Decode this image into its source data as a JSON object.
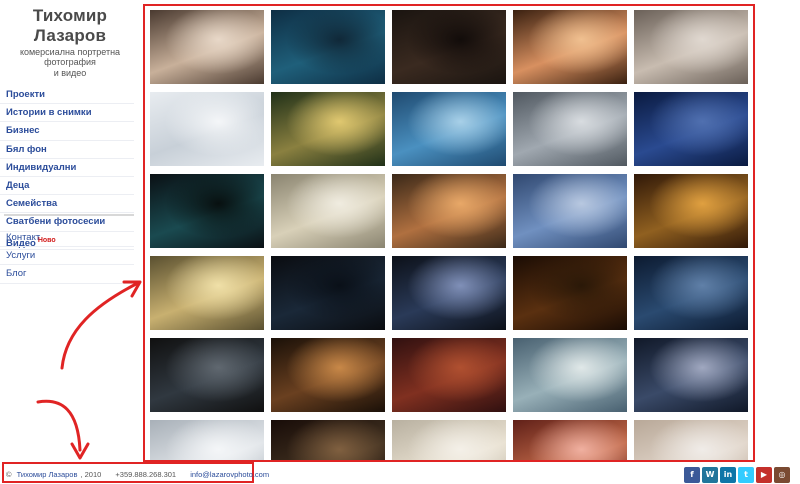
{
  "brand": {
    "name": "Тихомир Лазаров",
    "tagline_1": "комерсиална портретна фотография",
    "tagline_2": "и видео"
  },
  "nav": {
    "items": [
      {
        "label": "Проекти"
      },
      {
        "label": "Истории в снимки"
      },
      {
        "label": "Бизнес"
      },
      {
        "label": "Бял фон"
      },
      {
        "label": "Индивидуални"
      },
      {
        "label": "Деца"
      },
      {
        "label": "Семейства"
      },
      {
        "label": "Сватбени фотосесии"
      },
      {
        "label": "Видео",
        "badge": "Ново"
      }
    ],
    "secondary": [
      {
        "label": "Контакт"
      },
      {
        "label": "Услуги"
      },
      {
        "label": "Блог"
      }
    ]
  },
  "footer": {
    "copyright": "©",
    "name": "Тихомир Лазаров",
    "year": ", 2010",
    "phone": "+359.888.268.301",
    "email": "info@lazarovphoto.com"
  },
  "social": [
    {
      "icon": "facebook-icon",
      "glyph": "f",
      "color": "#3b5998"
    },
    {
      "icon": "wordpress-icon",
      "glyph": "W",
      "color": "#21759b"
    },
    {
      "icon": "linkedin-icon",
      "glyph": "in",
      "color": "#0e76a8"
    },
    {
      "icon": "twitter-icon",
      "glyph": "t",
      "color": "#33ccff"
    },
    {
      "icon": "youtube-icon",
      "glyph": "▶",
      "color": "#c4302b"
    },
    {
      "icon": "instagram-icon",
      "glyph": "◎",
      "color": "#7a4a32"
    }
  ],
  "colors": {
    "link": "#2b4c9a",
    "badge": "#d21a1a",
    "annotation": "#e02424"
  },
  "gallery": {
    "thumbs": [
      {
        "c": [
          "#4a3a30",
          "#c8b09a",
          "#e8d8c8"
        ],
        "name": "thumb-piano-room"
      },
      {
        "c": [
          "#0e2e44",
          "#1f5f7a",
          "#102838"
        ],
        "name": "thumb-underwater-woman"
      },
      {
        "c": [
          "#1a1410",
          "#3a2a20",
          "#120c0a"
        ],
        "name": "thumb-dark-doorway"
      },
      {
        "c": [
          "#3a2010",
          "#d89060",
          "#f0c090"
        ],
        "name": "thumb-portrait-woman"
      },
      {
        "c": [
          "#6a6058",
          "#c8bcb0",
          "#e0d8d0"
        ],
        "name": "thumb-typewriter"
      },
      {
        "c": [
          "#e8ecf0",
          "#c8d0d8",
          "#f4f6f8"
        ],
        "name": "thumb-snow-fight"
      },
      {
        "c": [
          "#203018",
          "#8a8040",
          "#e0c870"
        ],
        "name": "thumb-sunlit-forest"
      },
      {
        "c": [
          "#1f4a70",
          "#4a90c0",
          "#a8d0e8"
        ],
        "name": "thumb-car-shopping"
      },
      {
        "c": [
          "#505860",
          "#a0a8b0",
          "#d8dce0"
        ],
        "name": "thumb-businessman-car"
      },
      {
        "c": [
          "#0a1a40",
          "#2a4a90",
          "#5070b0"
        ],
        "name": "thumb-wedding-blue"
      },
      {
        "c": [
          "#0a1014",
          "#1a4a50",
          "#081010"
        ],
        "name": "thumb-pool-table"
      },
      {
        "c": [
          "#8a8470",
          "#d8d0b8",
          "#f0ece0"
        ],
        "name": "thumb-window-light"
      },
      {
        "c": [
          "#3a2818",
          "#b07040",
          "#e8a868"
        ],
        "name": "thumb-mountain-sunset"
      },
      {
        "c": [
          "#304870",
          "#7090c0",
          "#b8c8e0"
        ],
        "name": "thumb-mountain-woman"
      },
      {
        "c": [
          "#301808",
          "#906020",
          "#e0a040"
        ],
        "name": "thumb-forest-sunset"
      },
      {
        "c": [
          "#5a5030",
          "#c8b070",
          "#f0e0a8"
        ],
        "name": "thumb-lake-dock"
      },
      {
        "c": [
          "#0a0c10",
          "#1a2838",
          "#0a1018"
        ],
        "name": "thumb-trading-screens"
      },
      {
        "c": [
          "#0c1018",
          "#2a3a58",
          "#8090b8"
        ],
        "name": "thumb-guitarist"
      },
      {
        "c": [
          "#1a0c04",
          "#5a3010",
          "#2a1808"
        ],
        "name": "thumb-candle-writer"
      },
      {
        "c": [
          "#0c1a30",
          "#2a4a70",
          "#6080a8"
        ],
        "name": "thumb-blue-pillars"
      },
      {
        "c": [
          "#101010",
          "#303840",
          "#606870"
        ],
        "name": "thumb-car-headlights"
      },
      {
        "c": [
          "#1a1008",
          "#6a4020",
          "#c88848"
        ],
        "name": "thumb-reading-lamp"
      },
      {
        "c": [
          "#301010",
          "#803020",
          "#b05030"
        ],
        "name": "thumb-clock-room"
      },
      {
        "c": [
          "#486070",
          "#98b0b8",
          "#e0e8e8"
        ],
        "name": "thumb-lakeside-bride"
      },
      {
        "c": [
          "#101828",
          "#3a4a68",
          "#a0a8c0"
        ],
        "name": "thumb-night-wedding"
      },
      {
        "c": [
          "#a8b0b8",
          "#e0e4e8",
          "#f4f6f8"
        ],
        "name": "thumb-snow-rider"
      },
      {
        "c": [
          "#180c08",
          "#403020",
          "#806040"
        ],
        "name": "thumb-dark-hall"
      },
      {
        "c": [
          "#b8b0a0",
          "#e8e0d0",
          "#f4f0e8"
        ],
        "name": "thumb-white-columns"
      },
      {
        "c": [
          "#602018",
          "#c06848",
          "#f0b0a0"
        ],
        "name": "thumb-woman-closeup"
      },
      {
        "c": [
          "#b8a898",
          "#e0d4c8",
          "#f0ece8"
        ],
        "name": "thumb-bright-room"
      }
    ]
  }
}
